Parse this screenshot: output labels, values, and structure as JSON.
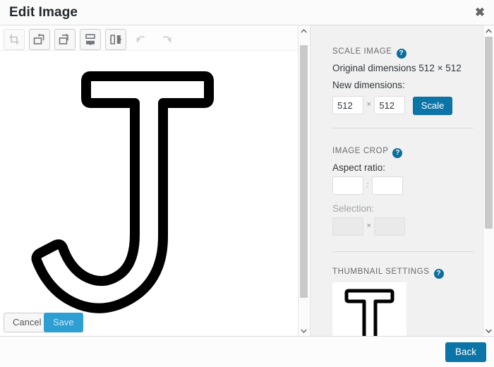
{
  "header": {
    "title": "Edit Image",
    "close_label": "✖"
  },
  "toolbar": {
    "buttons": [
      {
        "name": "crop",
        "label": "Crop",
        "enabled": false
      },
      {
        "name": "rotate-left",
        "label": "Rotate left",
        "enabled": true
      },
      {
        "name": "rotate-right",
        "label": "Rotate right",
        "enabled": true
      },
      {
        "name": "flip-vertical",
        "label": "Flip vertically",
        "enabled": true
      },
      {
        "name": "flip-horizontal",
        "label": "Flip horizontally",
        "enabled": true
      },
      {
        "name": "undo",
        "label": "Undo",
        "enabled": false
      },
      {
        "name": "redo",
        "label": "Redo",
        "enabled": false
      }
    ]
  },
  "editor": {
    "cancel_label": "Cancel",
    "save_label": "Save",
    "image_alt": "Outlined letter J"
  },
  "settings": {
    "scale": {
      "heading": "SCALE IMAGE",
      "help": "?",
      "original_dimensions": "Original dimensions 512 × 512",
      "new_dimensions_label": "New dimensions:",
      "width_value": "512",
      "height_value": "512",
      "separator": "×",
      "scale_button": "Scale"
    },
    "crop": {
      "heading": "IMAGE CROP",
      "help": "?",
      "aspect_ratio_label": "Aspect ratio:",
      "aspect_width_value": "",
      "aspect_height_value": "",
      "aspect_separator": ":",
      "selection_label": "Selection:",
      "selection_width_value": "",
      "selection_height_value": "",
      "selection_separator": "×"
    },
    "thumbnail": {
      "heading": "THUMBNAIL SETTINGS",
      "help": "?"
    }
  },
  "actionbar": {
    "back_label": "Back"
  },
  "colors": {
    "accent_blue": "#0b75a8",
    "help_blue": "#0b6e9e",
    "save_disabled_blue": "#2e9fd2",
    "panel_gray": "#f1f1f1",
    "text_dark": "#23282d",
    "text_muted": "#a0a5aa"
  }
}
